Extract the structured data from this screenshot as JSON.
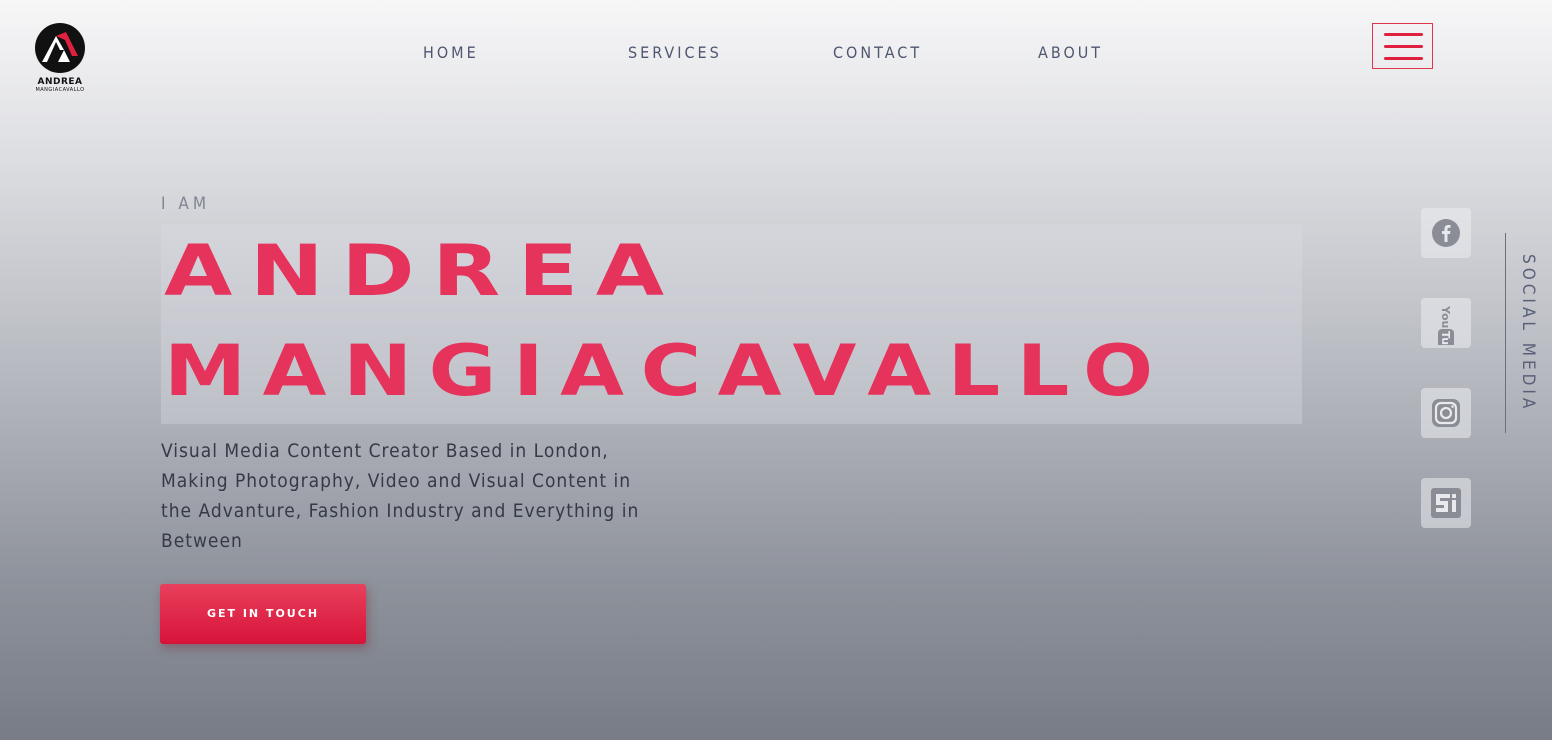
{
  "logo": {
    "name": "ANDREA",
    "subname": "MANGIACAVALLO",
    "colors": {
      "circle": "#111111",
      "accent": "#e0203f"
    }
  },
  "nav": {
    "items": [
      {
        "label": "HOME"
      },
      {
        "label": "SERVICES"
      },
      {
        "label": "CONTACT"
      },
      {
        "label": "ABOUT"
      }
    ],
    "menu_icon": "hamburger-icon"
  },
  "hero": {
    "intro": "I AM",
    "name_line1": "ANDREA",
    "name_line2": "MANGIACAVALLO",
    "description": "Visual Media Content Creator Based in London, Making Photography, Video and Visual Content in the Advanture, Fashion Industry and Everything in Between",
    "cta_label": "GET IN TOUCH"
  },
  "social": {
    "label": "SOCIAL MEDIA",
    "icons": [
      "facebook-icon",
      "youtube-icon",
      "instagram-icon",
      "issuu-icon"
    ]
  },
  "colors": {
    "accent": "#e6335c",
    "nav_text": "#4f5670",
    "body_text": "#363a45",
    "button": "#d8133a"
  }
}
